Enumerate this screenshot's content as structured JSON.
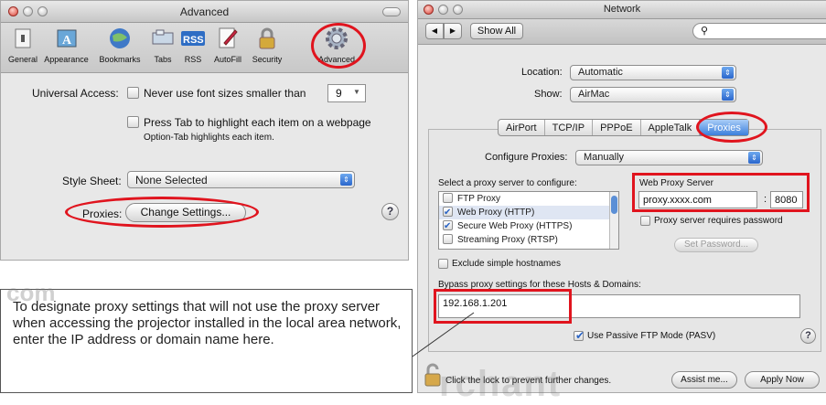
{
  "advanced_window": {
    "title": "Advanced",
    "toolbar": [
      {
        "label": "General",
        "icon": "general-icon"
      },
      {
        "label": "Appearance",
        "icon": "appearance-icon"
      },
      {
        "label": "Bookmarks",
        "icon": "bookmarks-icon"
      },
      {
        "label": "Tabs",
        "icon": "tabs-icon"
      },
      {
        "label": "RSS",
        "icon": "rss-icon"
      },
      {
        "label": "AutoFill",
        "icon": "autofill-icon"
      },
      {
        "label": "Security",
        "icon": "security-icon"
      },
      {
        "label": "Advanced",
        "icon": "gear-icon"
      }
    ],
    "universal_access_label": "Universal Access:",
    "min_font_label": "Never use font sizes smaller than",
    "min_font_value": "9",
    "press_tab_label": "Press Tab to highlight each item on a webpage",
    "press_tab_hint": "Option-Tab highlights each item.",
    "style_sheet_label": "Style Sheet:",
    "style_sheet_value": "None Selected",
    "proxies_label": "Proxies:",
    "change_settings": "Change Settings...",
    "help": "?"
  },
  "network_window": {
    "title": "Network",
    "back": "◀",
    "forward": "▶",
    "show_all": "Show All",
    "search_icon": "search-icon",
    "location_label": "Location:",
    "location_value": "Automatic",
    "show_label": "Show:",
    "show_value": "AirMac",
    "tabs": [
      "AirPort",
      "TCP/IP",
      "PPPoE",
      "AppleTalk",
      "Proxies"
    ],
    "selected_tab": "Proxies",
    "configure_label": "Configure Proxies:",
    "configure_value": "Manually",
    "select_label": "Select a proxy server to configure:",
    "proxies": [
      {
        "label": "FTP Proxy",
        "checked": false
      },
      {
        "label": "Web Proxy (HTTP)",
        "checked": true
      },
      {
        "label": "Secure Web Proxy (HTTPS)",
        "checked": true
      },
      {
        "label": "Streaming Proxy (RTSP)",
        "checked": false
      }
    ],
    "web_proxy_label": "Web Proxy Server",
    "web_proxy_host": "proxy.xxxx.com",
    "colon": ":",
    "web_proxy_port": "8080",
    "requires_password": "Proxy server requires password",
    "set_password": "Set Password...",
    "exclude_simple": "Exclude simple hostnames",
    "bypass_label": "Bypass proxy settings for these Hosts & Domains:",
    "bypass_value": "192.168.1.201",
    "passive_ftp": "Use Passive FTP Mode (PASV)",
    "help": "?",
    "lock_text": "Click the lock to prevent further changes.",
    "assist_me": "Assist me...",
    "apply_now": "Apply Now"
  },
  "caption": {
    "text": "To designate proxy settings that will not use the proxy server when accessing the projector installed in the local area network, enter the IP address or domain name here.",
    "watermark_top": "com",
    "watermark_bottom": "rchant"
  },
  "colors": {
    "highlight": "#e0141e",
    "accent": "#3b7fdc"
  }
}
